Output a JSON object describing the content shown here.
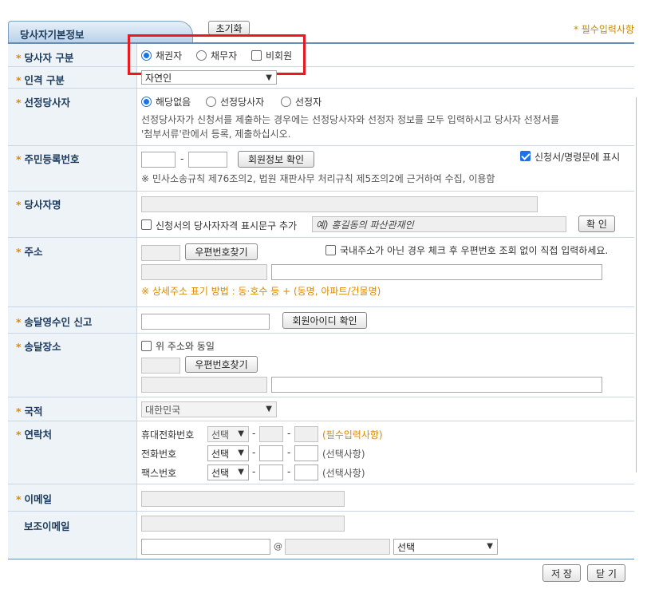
{
  "header": {
    "tab_title": "당사자기본정보",
    "reset_button": "초기화",
    "required_note": "* 필수입력사항"
  },
  "party_type": {
    "label": "당사자 구분",
    "options": [
      "채권자",
      "채무자",
      "비회원"
    ],
    "selected": "채권자"
  },
  "person_type": {
    "label": "인격 구분",
    "value": "자연인"
  },
  "designated": {
    "label": "선정당사자",
    "options": [
      "해당없음",
      "선정당사자",
      "선정자"
    ],
    "selected": "해당없음",
    "help_line1": "선정당사자가 신청서를 제출하는 경우에는 선정당사자와 선정자 정보를 모두 입력하시고 당사자 선정서를",
    "help_line2": "'첨부서류'란에서 등록, 제출하십시오."
  },
  "rrn": {
    "label": "주민등록번호",
    "dash": "-",
    "verify_button": "회원정보 확인",
    "display_option": "신청서/명령문에 표시",
    "note": "※ 민사소송규칙 제76조의2, 법원 재판사무 처리규칙 제5조의2에 근거하여 수집, 이용함"
  },
  "party_name": {
    "label": "당사자명",
    "title_option": "신청서의 당사자자격 표시문구 추가",
    "title_placeholder": "예) 홍길동의 파산관재인",
    "confirm_button": "확 인"
  },
  "address": {
    "label": "주소",
    "postcode_button": "우편번호찾기",
    "foreign_option": "국내주소가 아닌 경우 체크 후 우편번호 조회 없이 직접 입력하세요.",
    "detail_hint": "※ 상세주소 표기 방법 : 동·호수 등 + (동명, 아파트/건물명)"
  },
  "delivery_receiver": {
    "label": "송달영수인 신고",
    "member_id_button": "회원아이디 확인"
  },
  "delivery_place": {
    "label": "송달장소",
    "same_option": "위 주소와 동일",
    "postcode_button": "우편번호찾기"
  },
  "nationality": {
    "label": "국적",
    "value": "대한민국"
  },
  "contact": {
    "label": "연락처",
    "rows": [
      {
        "name": "휴대전화번호",
        "select": "선택",
        "note": "(필수입력사항)"
      },
      {
        "name": "전화번호",
        "select": "선택",
        "note": "(선택사항)"
      },
      {
        "name": "팩스번호",
        "select": "선택",
        "note": "(선택사항)"
      }
    ],
    "dash": "-"
  },
  "email": {
    "label": "이메일"
  },
  "sub_email": {
    "label": "보조이메일",
    "at": "@",
    "domain_select": "선택"
  },
  "footer": {
    "save_button": "저 장",
    "close_button": "닫 기"
  },
  "colors": {
    "accent": "#1a73e8",
    "required_star": "#e08a00",
    "highlight_box": "#e8191f",
    "label_text": "#1b3a5c"
  }
}
